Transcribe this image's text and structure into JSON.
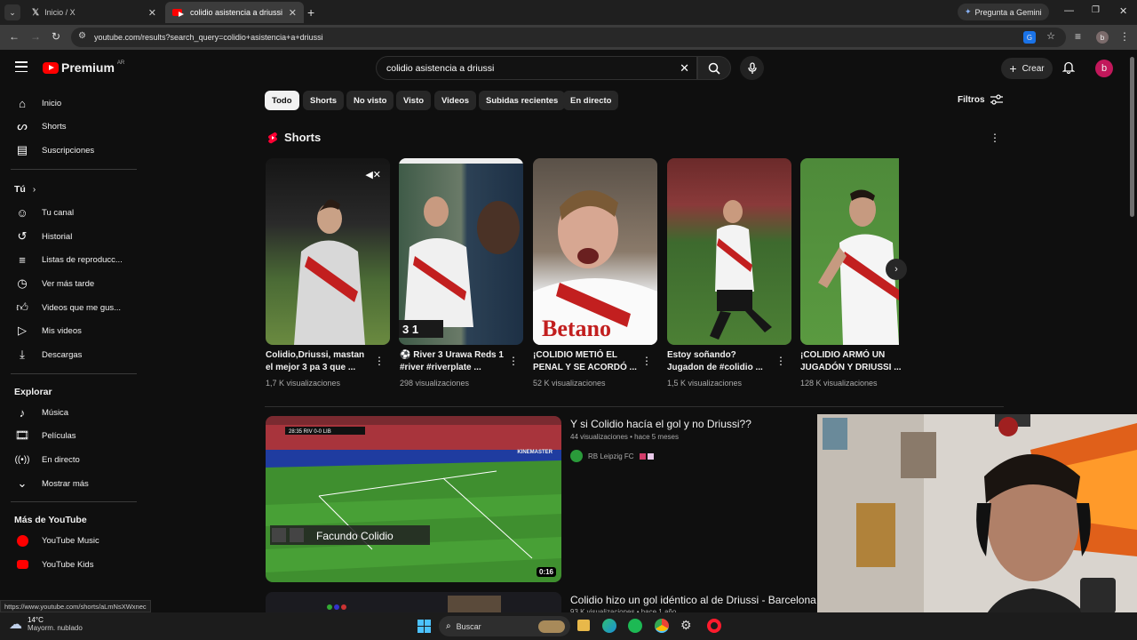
{
  "browser": {
    "tabs": [
      {
        "title": "Inicio / X",
        "active": false
      },
      {
        "title": "colidio asistencia a driussi - YouTube",
        "active": true
      }
    ],
    "gemini_label": "Pregunta a Gemini",
    "url": "youtube.com/results?search_query=colidio+asistencia+a+driussi",
    "profile_initial": "b"
  },
  "header": {
    "logo_text": "Premium",
    "country": "AR",
    "search_value": "colidio asistencia a driussi",
    "create_label": "Crear",
    "avatar_initial": "b"
  },
  "sidebar": {
    "main": [
      {
        "label": "Inicio",
        "icon": "home-icon"
      },
      {
        "label": "Shorts",
        "icon": "shorts-icon"
      },
      {
        "label": "Suscripciones",
        "icon": "subscriptions-icon"
      }
    ],
    "you_header": "Tú",
    "you": [
      {
        "label": "Tu canal",
        "icon": "channel-icon"
      },
      {
        "label": "Historial",
        "icon": "history-icon"
      },
      {
        "label": "Listas de reproducc...",
        "icon": "playlist-icon"
      },
      {
        "label": "Ver más tarde",
        "icon": "clock-icon"
      },
      {
        "label": "Videos que me gus...",
        "icon": "like-icon"
      },
      {
        "label": "Mis videos",
        "icon": "my-videos-icon"
      },
      {
        "label": "Descargas",
        "icon": "download-icon"
      }
    ],
    "explore_header": "Explorar",
    "explore": [
      {
        "label": "Música",
        "icon": "music-icon"
      },
      {
        "label": "Películas",
        "icon": "movies-icon"
      },
      {
        "label": "En directo",
        "icon": "live-icon"
      },
      {
        "label": "Mostrar más",
        "icon": "chevron-down-icon"
      }
    ],
    "more_header": "Más de YouTube",
    "more": [
      {
        "label": "YouTube Music",
        "icon": "yt-music-icon"
      },
      {
        "label": "YouTube Kids",
        "icon": "yt-kids-icon"
      }
    ]
  },
  "chips": [
    "Todo",
    "Shorts",
    "No visto",
    "Visto",
    "Videos",
    "Subidas recientes",
    "En directo"
  ],
  "filters_label": "Filtros",
  "shorts_section": {
    "title": "Shorts",
    "items": [
      {
        "title": "Colidio,Driussi, mastan el mejor 3 pa 3 que ...",
        "views": "1,7 K visualizaciones"
      },
      {
        "title": "⚽ River 3 Urawa Reds 1 #river #riverplate ...",
        "views": "298 visualizaciones"
      },
      {
        "title": "¡COLIDIO METIÓ EL PENAL Y SE ACORDÓ ...",
        "views": "52 K visualizaciones"
      },
      {
        "title": "Estoy soñando? Jugadon de #colidio ...",
        "views": "1,5 K visualizaciones"
      },
      {
        "title": "¡COLIDIO ARMÓ UN JUGADÓN Y DRIUSSI ...",
        "views": "128 K visualizaciones"
      }
    ]
  },
  "videos": [
    {
      "title": "Y si Colidio hacía el gol y no Driussi??",
      "meta": "44 visualizaciones • hace 5 meses",
      "channel": "RB Leipzig FC",
      "overlay_text": "Facundo Colidio",
      "duration": "0:16",
      "watermark": "KINEMASTER"
    },
    {
      "title": "Colidio hizo un gol idéntico al de Driussi - Barcelona",
      "meta": "93 K visualizaciones • hace 1 año"
    }
  ],
  "status_url": "https://www.youtube.com/shorts/aLmNsXWxnec",
  "taskbar": {
    "weather_temp": "14°C",
    "weather_desc": "Mayorm. nublado",
    "search_label": "Buscar"
  }
}
